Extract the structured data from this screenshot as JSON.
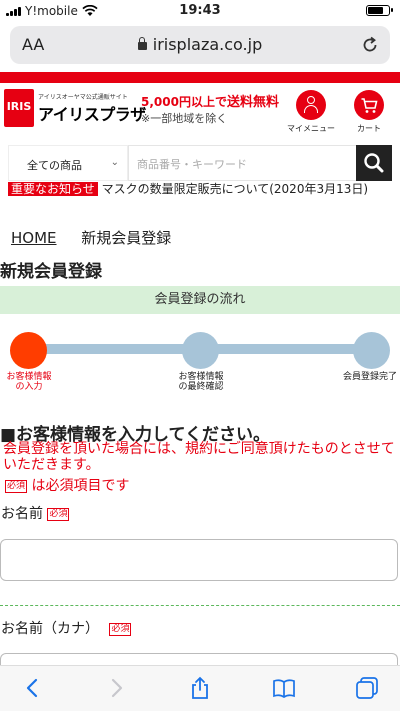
{
  "status_bar": {
    "carrier": "Y!mobile",
    "time": "19:43"
  },
  "browser": {
    "text_size_label": "AA",
    "url": "irisplaza.co.jp"
  },
  "site": {
    "logo_mark": "IRIS",
    "logo_subtitle": "アイリスオーヤマ公式通販サイト",
    "logo_name": "アイリスプラザ",
    "shipping_amount": "5,000円以上で",
    "shipping_free": "送料無料",
    "shipping_note": "※一部地域を除く",
    "my_menu_label": "マイメニュー",
    "cart_label": "カート"
  },
  "search": {
    "category": "全ての商品",
    "placeholder": "商品番号・キーワード"
  },
  "notice": {
    "tag": "重要なお知らせ",
    "text": "マスクの数量限定販売について(2020年3月13日)"
  },
  "breadcrumb": {
    "home": "HOME",
    "current": "新規会員登録"
  },
  "page_title": "新規会員登録",
  "flow": {
    "title": "会員登録の流れ",
    "steps": [
      {
        "line1": "お客様情報",
        "line2": "の入力"
      },
      {
        "line1": "お客様情報",
        "line2": "の最終確認"
      },
      {
        "line1": "会員登録完了",
        "line2": ""
      }
    ]
  },
  "form": {
    "heading": "■お客様情報を入力してください。",
    "agreement": "会員登録を頂いた場合には、規約にご同意頂けたものとさせていただきます。",
    "required_badge": "必須",
    "required_note": "は必須項目です",
    "fields": [
      {
        "label": "お名前",
        "value": ""
      },
      {
        "label": "お名前（カナ）",
        "value": ""
      }
    ]
  },
  "colors": {
    "brand_red": "#e60012",
    "step_active": "#ff3d00",
    "step_inactive": "#a7c4d8",
    "flow_bg": "#d8f0d8"
  }
}
